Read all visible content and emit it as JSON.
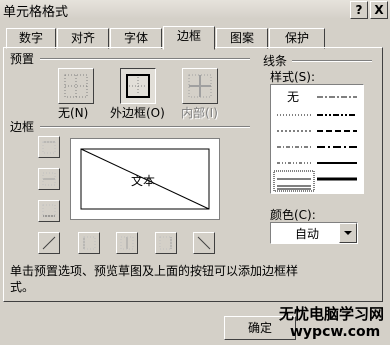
{
  "window": {
    "title": "单元格格式",
    "help_label": "?",
    "close_label": "X"
  },
  "tabs": [
    {
      "label": "数字"
    },
    {
      "label": "对齐"
    },
    {
      "label": "字体"
    },
    {
      "label": "边框"
    },
    {
      "label": "图案"
    },
    {
      "label": "保护"
    }
  ],
  "presets": {
    "group_label": "预置",
    "none_label": "无(N)",
    "outline_label": "外边框(O)",
    "inside_label": "内部(I)"
  },
  "border": {
    "group_label": "边框",
    "preview_text": "文本"
  },
  "line": {
    "group_label": "线条",
    "style_label": "样式(S):",
    "style_none": "无",
    "color_label": "颜色(C):",
    "color_value": "自动"
  },
  "hint": "单击预置选项、预览草图及上面的按钮可以添加边框样式。",
  "buttons": {
    "ok": "确定"
  },
  "watermark": {
    "line1": "无忧电脑学习网",
    "line2": "wypcw.com"
  }
}
